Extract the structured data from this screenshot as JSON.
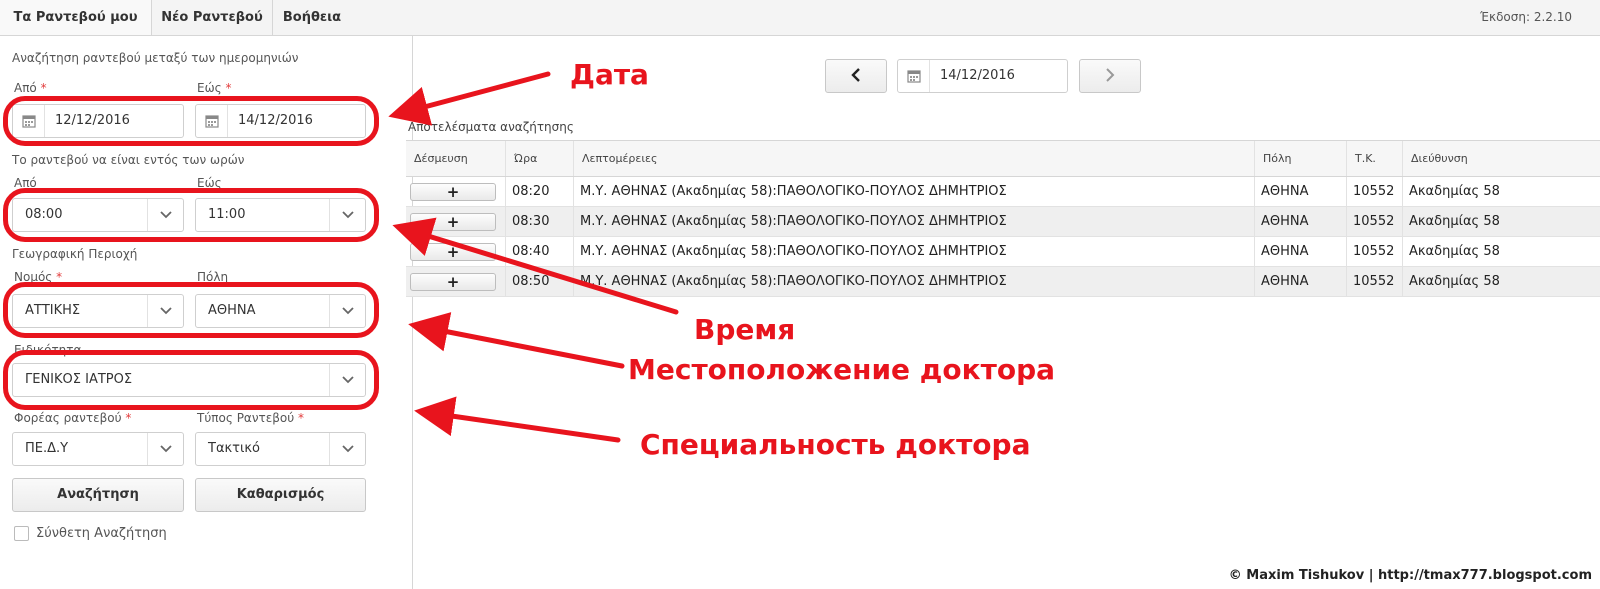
{
  "nav": {
    "tabs": [
      "Τα Ραντεβού μου",
      "Νέο Ραντεβού",
      "Βοήθεια"
    ],
    "version": "Έκδοση: 2.2.10"
  },
  "search": {
    "title": "Αναζήτηση ραντεβού μεταξύ των ημερομηνιών",
    "from_label": "Από",
    "to_label": "Εώς",
    "date_from": "12/12/2016",
    "date_to": "14/12/2016",
    "hours_title": "Το ραντεβού να είναι εντός των ωρών",
    "hours_from_label": "Από",
    "hours_to_label": "Εώς",
    "hour_from": "08:00",
    "hour_to": "11:00",
    "geo_title": "Γεωγραφική Περιοχή",
    "prefecture_label": "Νομός",
    "city_label": "Πόλη",
    "prefecture": "ΑΤΤΙΚΗΣ",
    "city": "ΑΘΗΝΑ",
    "specialty_label": "Ειδικότητα",
    "specialty": "ΓΕΝΙΚΟΣ ΙΑΤΡΟΣ",
    "provider_label": "Φορέας ραντεβού",
    "type_label": "Τύπος Ραντεβού",
    "provider": "ΠΕ.Δ.Υ",
    "appt_type": "Τακτικό",
    "search_button": "Αναζήτηση",
    "clear_button": "Καθαρισμός",
    "advanced_label": "Σύνθετη Αναζήτηση",
    "required_mark": "*"
  },
  "datenav": {
    "current_date": "14/12/2016"
  },
  "results": {
    "title": "Αποτελέσματα αναζήτησης",
    "columns": [
      "Δέσμευση",
      "Ώρα",
      "Λεπτομέρειες",
      "Πόλη",
      "Τ.Κ.",
      "Διεύθυνση"
    ],
    "book_symbol": "+",
    "rows": [
      {
        "time": "08:20",
        "details": "Μ.Υ. ΑΘΗΝΑΣ (Ακαδημίας 58):ΠΑΘΟΛΟΓΙΚΟ-ΠΟΥΛΟΣ ΔΗΜΗΤΡΙΟΣ",
        "city": "ΑΘΗΝΑ",
        "zip": "10552",
        "address": "Ακαδημίας 58"
      },
      {
        "time": "08:30",
        "details": "Μ.Υ. ΑΘΗΝΑΣ (Ακαδημίας 58):ΠΑΘΟΛΟΓΙΚΟ-ΠΟΥΛΟΣ ΔΗΜΗΤΡΙΟΣ",
        "city": "ΑΘΗΝΑ",
        "zip": "10552",
        "address": "Ακαδημίας 58"
      },
      {
        "time": "08:40",
        "details": "Μ.Υ. ΑΘΗΝΑΣ (Ακαδημίας 58):ΠΑΘΟΛΟΓΙΚΟ-ΠΟΥΛΟΣ ΔΗΜΗΤΡΙΟΣ",
        "city": "ΑΘΗΝΑ",
        "zip": "10552",
        "address": "Ακαδημίας 58"
      },
      {
        "time": "08:50",
        "details": "Μ.Υ. ΑΘΗΝΑΣ (Ακαδημίας 58):ΠΑΘΟΛΟΓΙΚΟ-ΠΟΥΛΟΣ ΔΗΜΗΤΡΙΟΣ",
        "city": "ΑΘΗΝΑ",
        "zip": "10552",
        "address": "Ακαδημίας 58"
      }
    ]
  },
  "annotations": {
    "date": "Дата",
    "time": "Время",
    "location": "Местоположение доктора",
    "specialty": "Специальность доктора",
    "color": "#e8141d"
  },
  "copyright": "© Maxim Tishukov | http://tmax777.blogspot.com",
  "icons": [
    "calendar-icon",
    "chevron-down-icon",
    "chevron-left-icon",
    "chevron-right-icon",
    "plus-icon"
  ]
}
